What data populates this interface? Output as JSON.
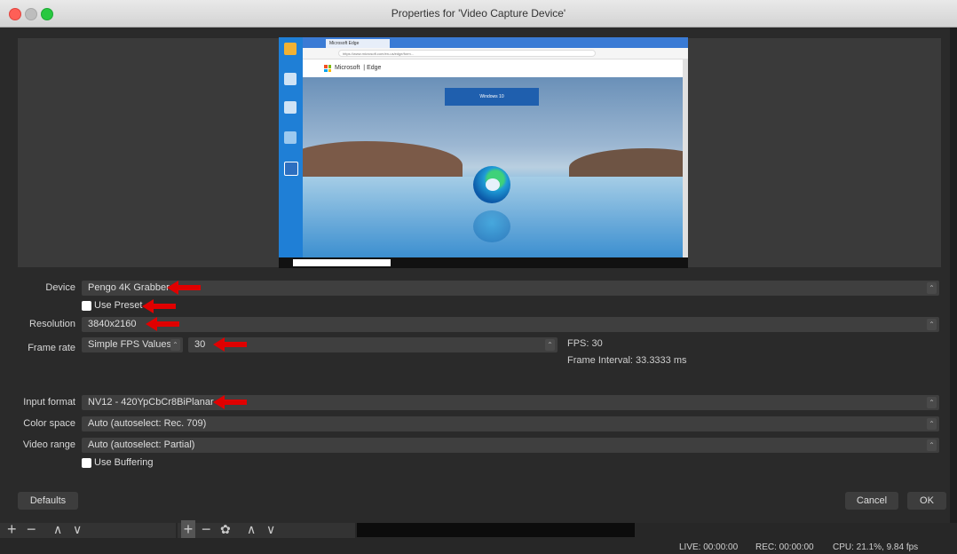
{
  "window": {
    "title": "Properties for 'Video Capture Device'"
  },
  "preview": {
    "browser_tab": "Microsoft Edge",
    "address": "https://www.microsoft.com/en-us/edge/form...",
    "brand": "Microsoft",
    "product": "Edge",
    "banner": "Windows 10"
  },
  "form": {
    "device": {
      "label": "Device",
      "value": "Pengo 4K Grabber"
    },
    "use_preset": {
      "label": "Use Preset",
      "checked": false
    },
    "resolution": {
      "label": "Resolution",
      "value": "3840x2160"
    },
    "frame_rate": {
      "label": "Frame rate",
      "mode": "Simple FPS Values",
      "value": "30"
    },
    "fps_info": "FPS: 30",
    "frame_interval": "Frame Interval: 33.3333 ms",
    "input_format": {
      "label": "Input format",
      "value": "NV12 - 420YpCbCr8BiPlanar"
    },
    "color_space": {
      "label": "Color space",
      "value": "Auto (autoselect: Rec. 709)"
    },
    "video_range": {
      "label": "Video range",
      "value": "Auto (autoselect: Partial)"
    },
    "use_buffering": {
      "label": "Use Buffering",
      "checked": false
    }
  },
  "buttons": {
    "defaults": "Defaults",
    "cancel": "Cancel",
    "ok": "OK"
  },
  "toolbar": {
    "add": "+",
    "remove": "−",
    "up": "∧",
    "down": "∨",
    "settings": "✿"
  },
  "status": {
    "live": "LIVE: 00:00:00",
    "rec": "REC: 00:00:00",
    "cpu": "CPU: 21.1%, 9.84 fps"
  },
  "colors": {
    "annotation_arrow": "#e00000",
    "panel": "#2a2a2a",
    "field": "#3f3f3f"
  }
}
